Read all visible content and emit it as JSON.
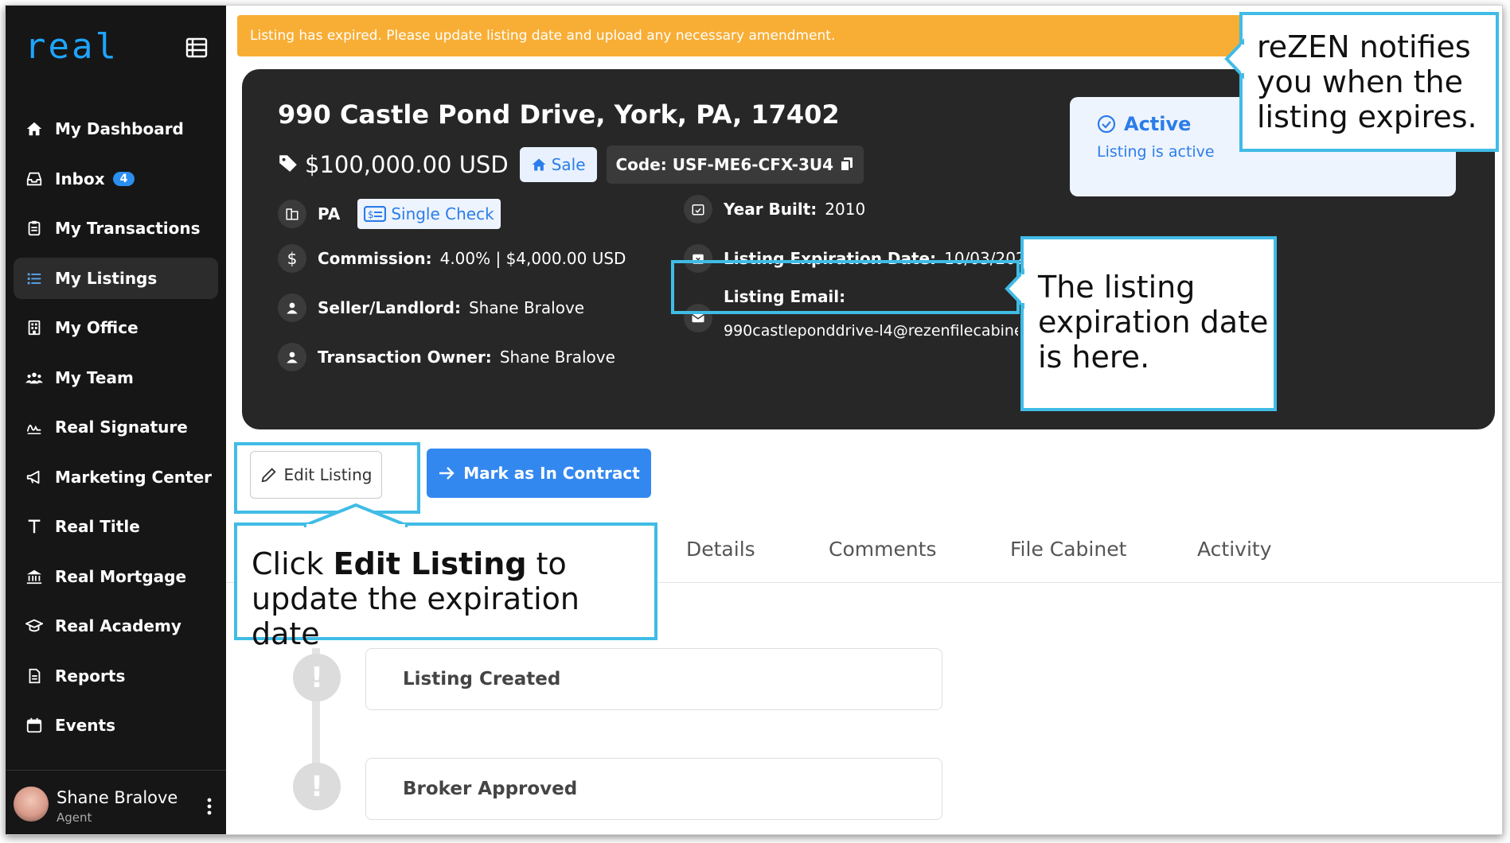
{
  "app": {
    "logo": "real"
  },
  "sidebar": {
    "items": [
      {
        "label": "My Dashboard",
        "icon": "home-icon"
      },
      {
        "label": "Inbox",
        "icon": "inbox-icon",
        "badge": "4"
      },
      {
        "label": "My Transactions",
        "icon": "clipboard-icon"
      },
      {
        "label": "My Listings",
        "icon": "list-icon",
        "active": true
      },
      {
        "label": "My Office",
        "icon": "building-icon"
      },
      {
        "label": "My Team",
        "icon": "team-icon"
      },
      {
        "label": "Real Signature",
        "icon": "signature-icon"
      },
      {
        "label": "Marketing Center",
        "icon": "megaphone-icon"
      },
      {
        "label": "Real Title",
        "icon": "title-t-icon"
      },
      {
        "label": "Real Mortgage",
        "icon": "bank-icon"
      },
      {
        "label": "Real Academy",
        "icon": "graduation-cap-icon"
      },
      {
        "label": "Reports",
        "icon": "report-icon"
      },
      {
        "label": "Events",
        "icon": "calendar-icon"
      }
    ],
    "user": {
      "name": "Shane Bralove",
      "role": "Agent"
    }
  },
  "banner": {
    "text": "Listing has expired. Please update listing date and upload any necessary amendment."
  },
  "listing": {
    "address": "990 Castle Pond Drive, York, PA, 17402",
    "price": "$100,000.00 USD",
    "type": "Sale",
    "code": "Code: USF-ME6-CFX-3U4",
    "state": "PA",
    "check_type": "Single Check",
    "commission_label": "Commission:",
    "commission_value": "4.00% | $4,000.00 USD",
    "seller_label": "Seller/Landlord:",
    "seller_value": "Shane Bralove",
    "owner_label": "Transaction Owner:",
    "owner_value": "Shane Bralove",
    "year_label": "Year Built:",
    "year_value": "2010",
    "expiration_label": "Listing Expiration Date:",
    "expiration_value": "10/03/2023",
    "email_label": "Listing Email:",
    "email_value": "990castleponddrive-l4@rezenfilecabinet",
    "status_title": "Active",
    "status_sub": "Listing is active"
  },
  "actions": {
    "edit": "Edit Listing",
    "contract": "Mark as In Contract"
  },
  "tabs": [
    "Details",
    "Comments",
    "File Cabinet",
    "Activity"
  ],
  "timeline": [
    {
      "label": "Listing Created"
    },
    {
      "label": "Broker Approved"
    }
  ],
  "callouts": {
    "notify": "reZEN notifies you when the listing expires.",
    "expiration": "The listing expiration date is here.",
    "edit_prefix": "Click ",
    "edit_bold": "Edit Listing",
    "edit_suffix": " to update the expiration date"
  },
  "colors": {
    "accent": "#3388f0",
    "banner": "#f8ae35",
    "callout_border": "#40bce6",
    "sidebar": "#161616",
    "card": "#272727"
  }
}
